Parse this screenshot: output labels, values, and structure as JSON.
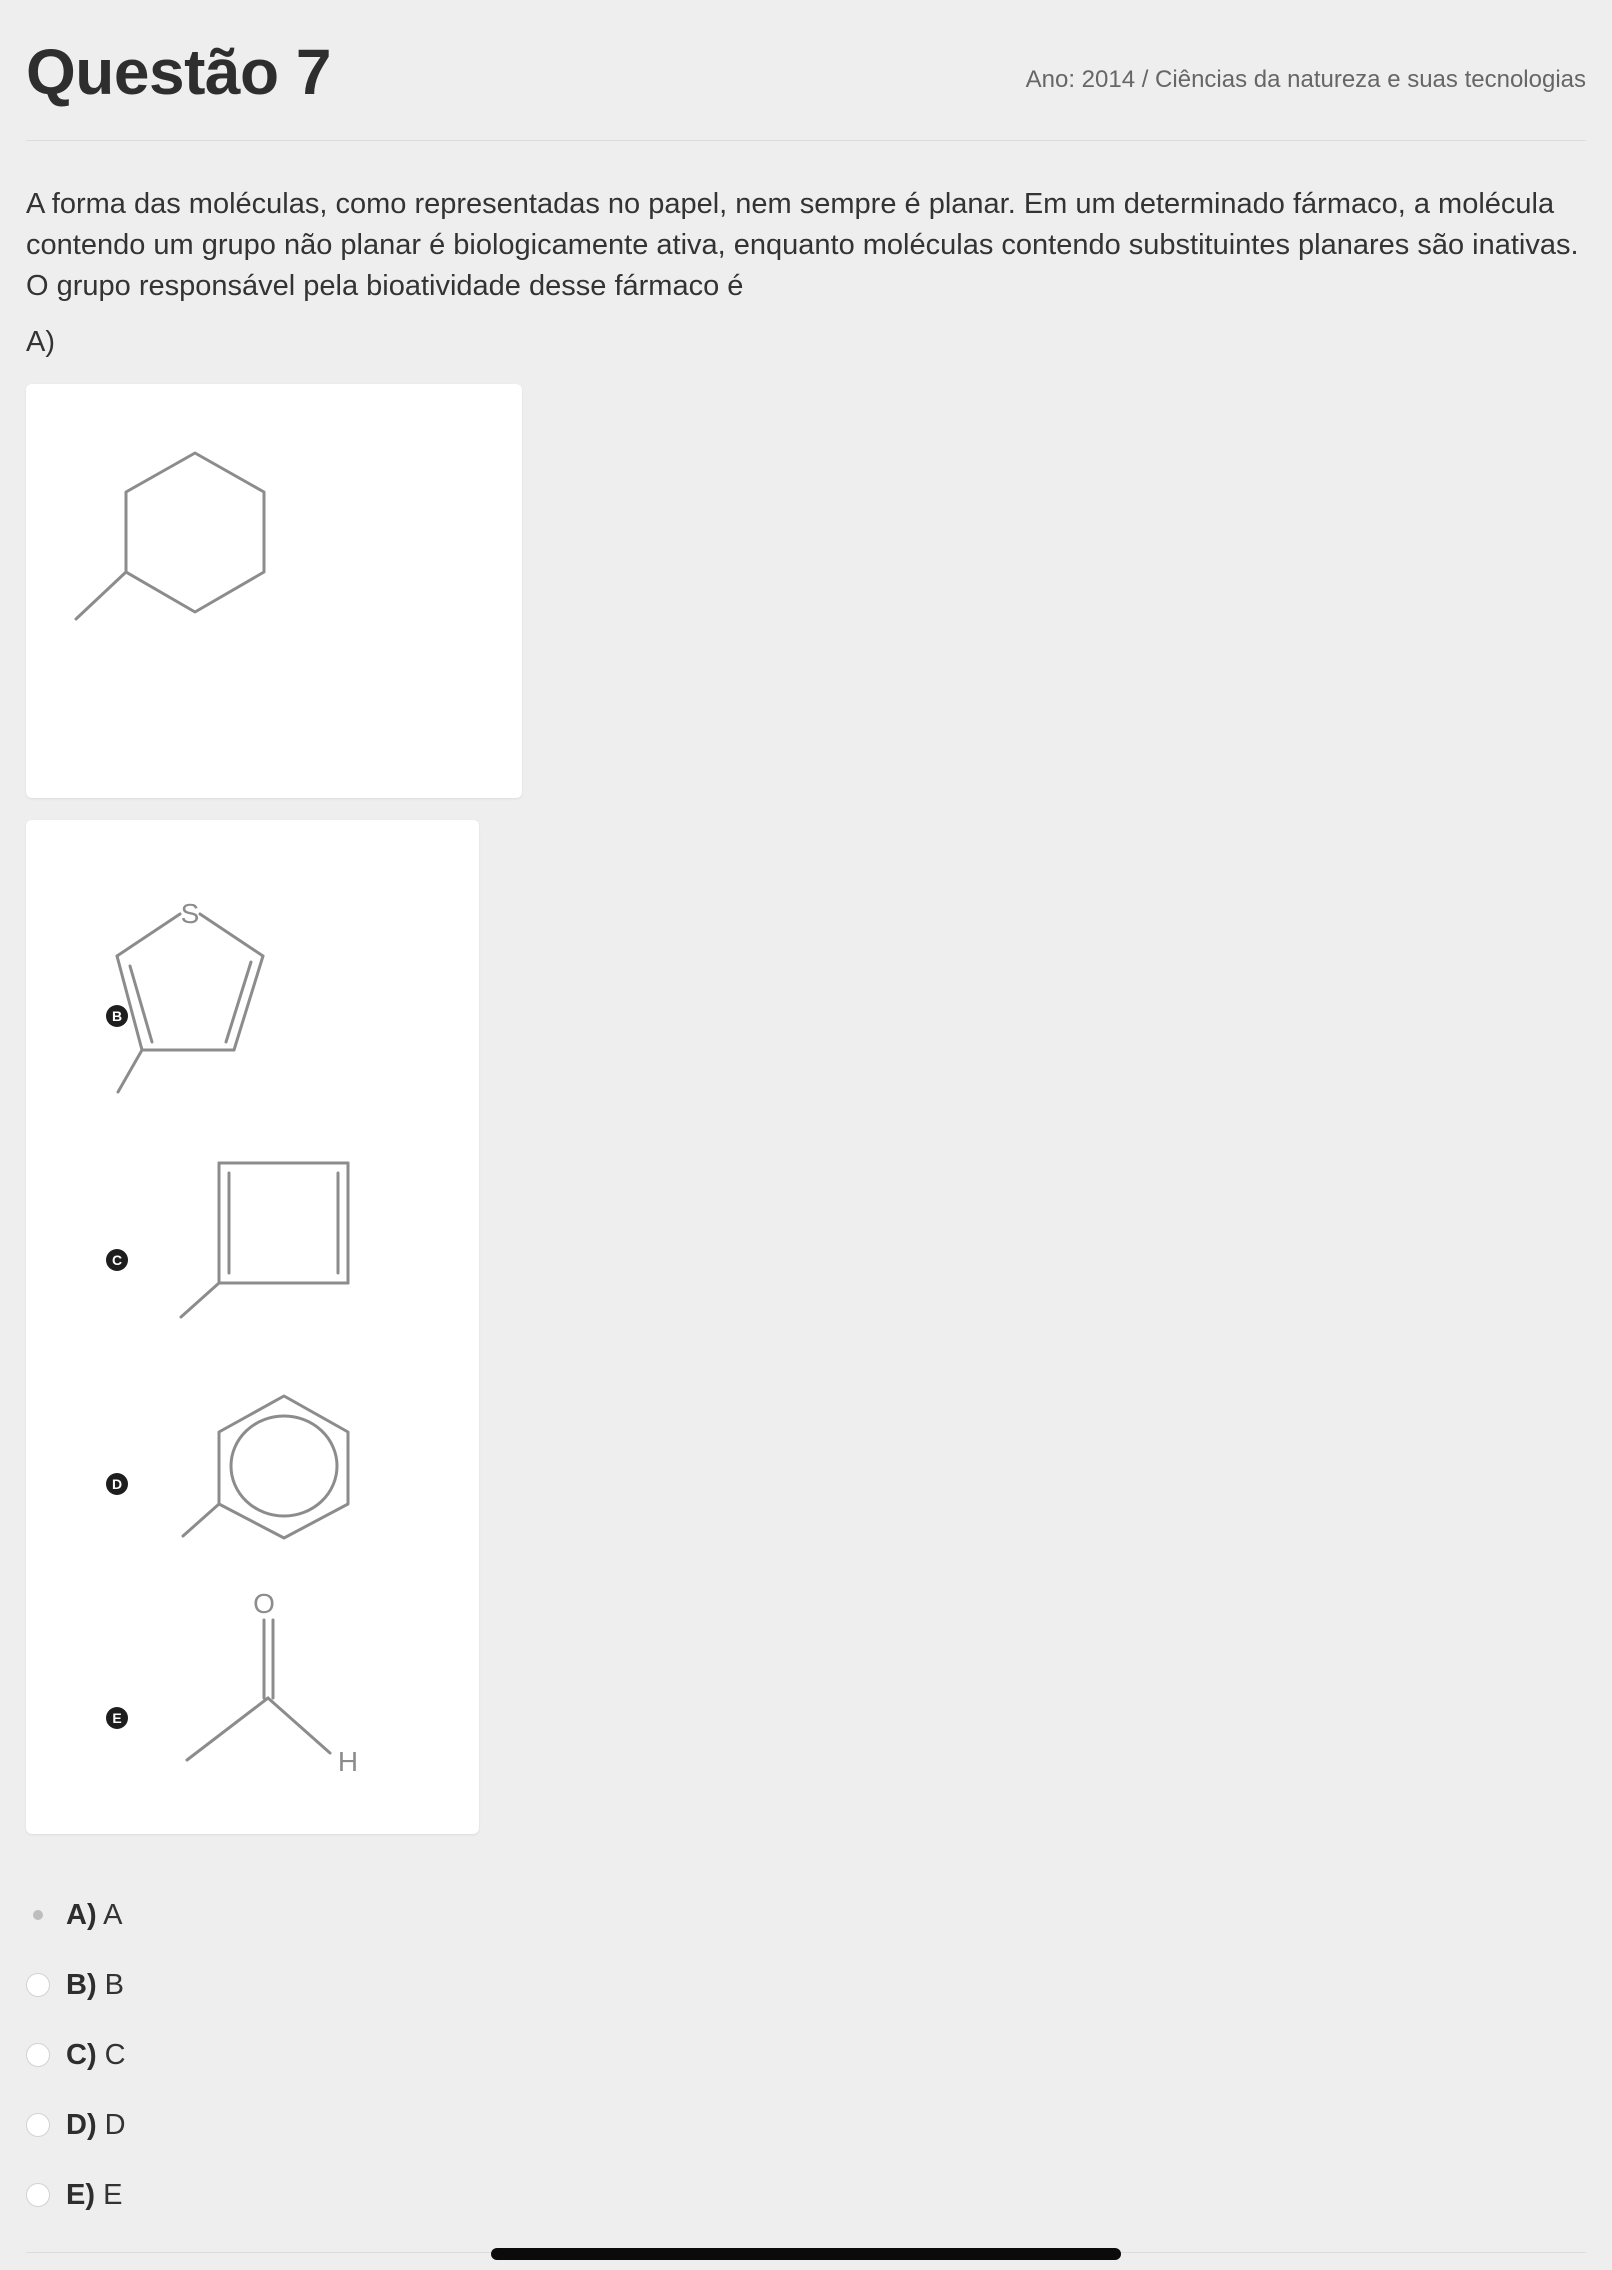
{
  "question": {
    "title": "Questão 7",
    "meta": "Ano: 2014 / Ciências da natureza e suas tecnologias",
    "statement": "A forma das moléculas, como representadas no papel, nem sempre é planar. Em um determinado fármaco, a molécula contendo um grupo não planar é biologicamente ativa, enquanto moléculas contendo substituintes planares são inativas. O grupo responsável pela bioatividade desse fármaco é",
    "option_a_label": "A)"
  },
  "figure": {
    "markers": [
      "B",
      "C",
      "D",
      "E"
    ],
    "atoms": {
      "sulfur": "S",
      "oxygen": "O",
      "hydrogen": "H"
    }
  },
  "answers": [
    {
      "letter": "A)",
      "text": "A",
      "selected": true
    },
    {
      "letter": "B)",
      "text": "B",
      "selected": false
    },
    {
      "letter": "C)",
      "text": "C",
      "selected": false
    },
    {
      "letter": "D)",
      "text": "D",
      "selected": false
    },
    {
      "letter": "E)",
      "text": "E",
      "selected": false
    }
  ],
  "colors": {
    "background": "#eeeeee",
    "card": "#ffffff",
    "bond": "#8c8c8c",
    "marker": "#1e1e1e",
    "text": "#333333",
    "meta_text": "#666666"
  }
}
